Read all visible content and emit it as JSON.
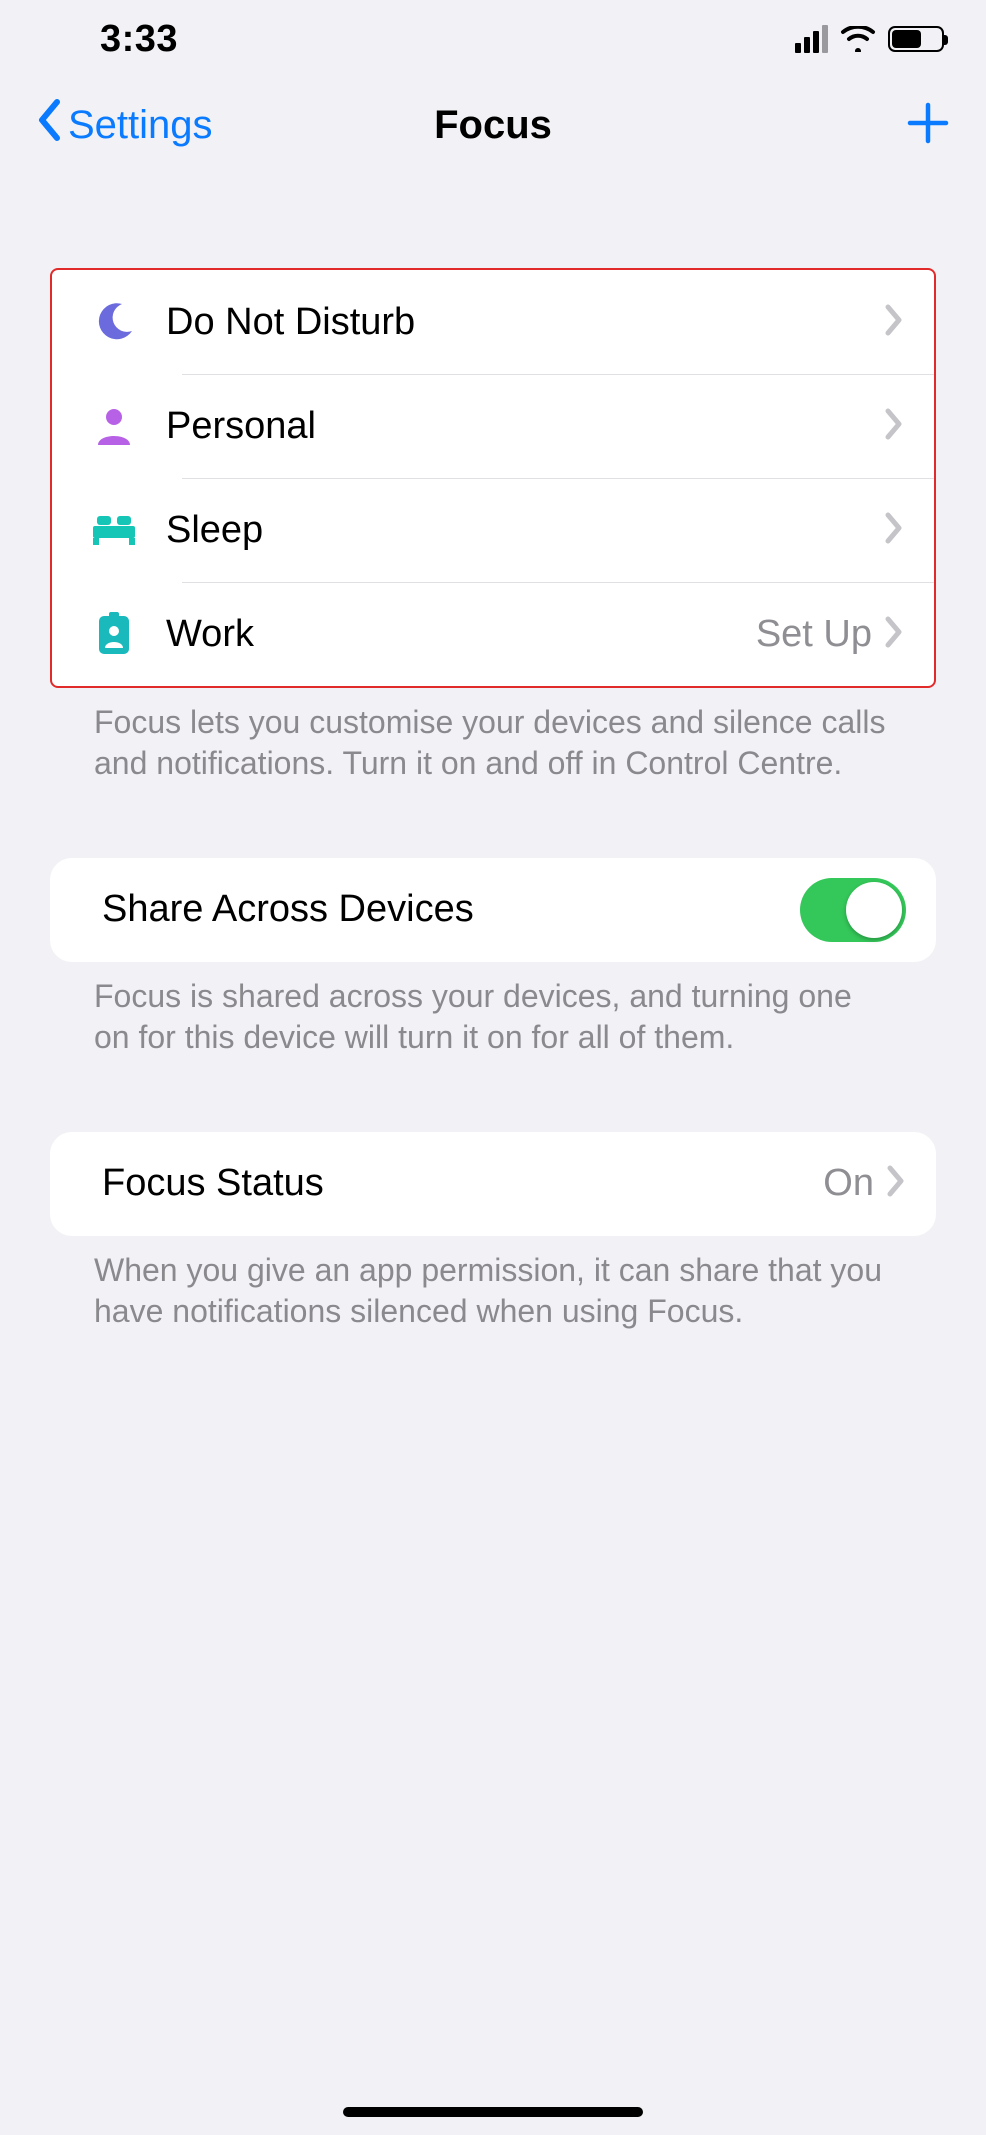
{
  "statusbar": {
    "time": "3:33"
  },
  "nav": {
    "back": "Settings",
    "title": "Focus"
  },
  "focus_items": [
    {
      "label": "Do Not Disturb",
      "detail": ""
    },
    {
      "label": "Personal",
      "detail": ""
    },
    {
      "label": "Sleep",
      "detail": ""
    },
    {
      "label": "Work",
      "detail": "Set Up"
    }
  ],
  "focus_footer": "Focus lets you customise your devices and silence calls and notifications. Turn it on and off in Control Centre.",
  "share": {
    "label": "Share Across Devices",
    "on": true,
    "footer": "Focus is shared across your devices, and turning one on for this device will turn it on for all of them."
  },
  "status": {
    "label": "Focus Status",
    "value": "On",
    "footer": "When you give an app permission, it can share that you have notifications silenced when using Focus."
  },
  "colors": {
    "dnd": "#6b6bdd",
    "personal": "#b762e6",
    "sleep": "#15c5b6",
    "work": "#1ab9bc",
    "accent": "#0a7aff",
    "toggle_on": "#34c759"
  }
}
